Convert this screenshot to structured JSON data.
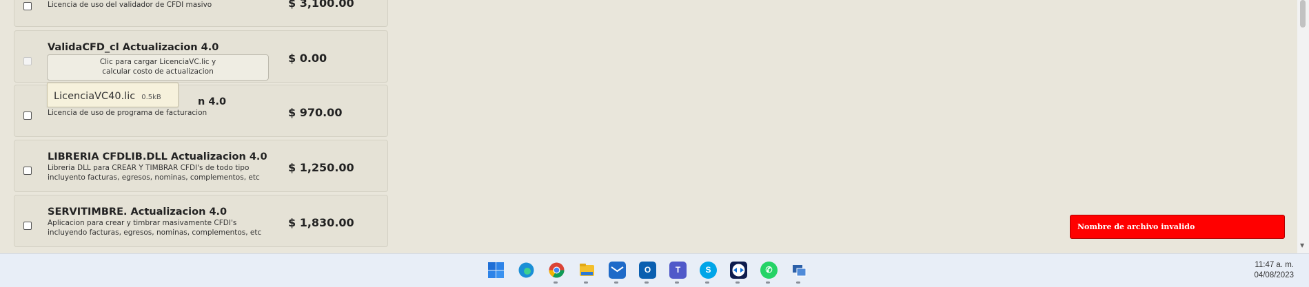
{
  "products": [
    {
      "title": "",
      "description": "Licencia de uso del validador de CFDI masivo",
      "price": "$ 3,100.00",
      "checked": false
    },
    {
      "title": "ValidaCFD_cl Actualizacion 4.0",
      "description": "",
      "price": "$ 0.00",
      "checked": false,
      "disabled": true,
      "load_button_line1": "Clic para cargar LicenciaVC.lic y",
      "load_button_line2": "calcular costo de actualizacion",
      "file_chip": {
        "name": "LicenciaVC40.lic",
        "size": "0.5kB"
      }
    },
    {
      "title_visible_part": "n 4.0",
      "description": "Licencia de uso de programa de facturacion",
      "price": "$ 970.00",
      "checked": false
    },
    {
      "title": "LIBRERIA CFDLIB.DLL Actualizacion 4.0",
      "description_line1": "Libreria DLL para CREAR Y TIMBRAR CFDI's de todo tipo",
      "description_line2": "incluyento facturas, egresos, nominas, complementos, etc",
      "price": "$ 1,250.00",
      "checked": false
    },
    {
      "title": "SERVITIMBRE. Actualizacion 4.0",
      "description_line1": "Aplicacion para crear y timbrar masivamente CFDI's",
      "description_line2": "incluyendo facturas, egresos, nominas, complementos, etc",
      "price": "$ 1,830.00",
      "checked": false
    }
  ],
  "toast": {
    "message": "Nombre de archivo invalido",
    "color": "#ff0000"
  },
  "taskbar": {
    "icons": [
      "windows-start-icon",
      "edge-icon",
      "chrome-icon",
      "file-explorer-icon",
      "mail-icon",
      "outlook-icon",
      "teams-icon",
      "skype-icon",
      "teamviewer-icon",
      "whatsapp-icon",
      "remote-desktop-icon"
    ],
    "time": "11:47 a. m.",
    "date": "04/08/2023"
  },
  "colors": {
    "page_bg": "#e9e6db",
    "card_bg": "#e5e2d6",
    "taskbar_bg": "#e8eef7"
  }
}
